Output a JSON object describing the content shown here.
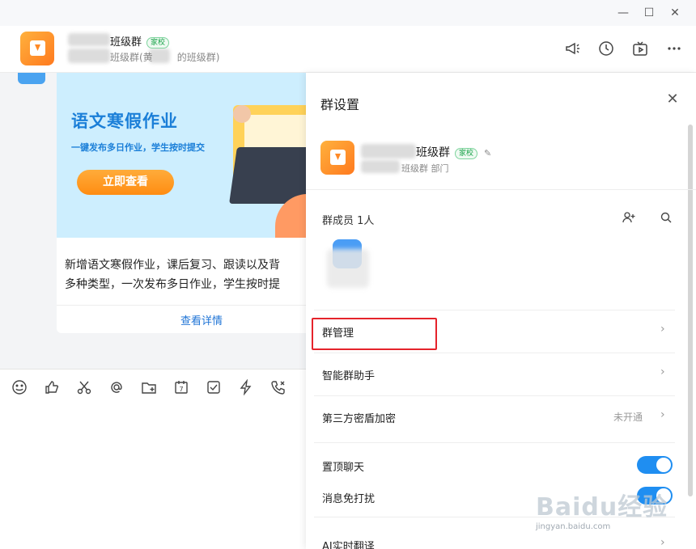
{
  "window": {
    "minimize_label": "—",
    "maximize_label": "☐",
    "close_label": "✕"
  },
  "header": {
    "title": "班级群",
    "tag": "家校",
    "subtitle": "班级群(黄",
    "subtitle_tail": "的班级群)",
    "icons": [
      "announcement-icon",
      "history-icon",
      "live-icon",
      "more-icon"
    ]
  },
  "card": {
    "banner_title": "语文寒假作业",
    "banner_subtitle": "一键发布多日作业，学生按时提交",
    "banner_button": "立即查看",
    "text_line1": "新增语文寒假作业，课后复习、跟读以及背",
    "text_line2": "多种类型，一次发布多日作业，学生按时提",
    "link": "查看详情"
  },
  "toolbar": {
    "icons": [
      "emoji-icon",
      "thumbs-up-icon",
      "scissors-icon",
      "at-icon",
      "folder-add-icon",
      "calendar-icon",
      "checkbox-icon",
      "lightning-icon",
      "phone-icon"
    ]
  },
  "panel": {
    "title": "群设置",
    "close_label": "✕",
    "group_name": "班级群",
    "group_tag": "家校",
    "group_sub": "班级群  部门",
    "members_label": "群成员 1人",
    "rows": [
      {
        "label": "群管理",
        "chevron": "›"
      },
      {
        "label": "智能群助手",
        "chevron": "›"
      },
      {
        "label": "第三方密盾加密",
        "value": "未开通",
        "chevron": "›"
      },
      {
        "label": "置顶聊天"
      },
      {
        "label": "消息免打扰"
      },
      {
        "label": "AI实时翻译",
        "chevron": "›"
      }
    ],
    "toggles": {
      "pin_chat": true,
      "do_not_disturb": true
    }
  },
  "watermark": {
    "main": "Baidu经验",
    "sub": "jingyan.baidu.com"
  }
}
